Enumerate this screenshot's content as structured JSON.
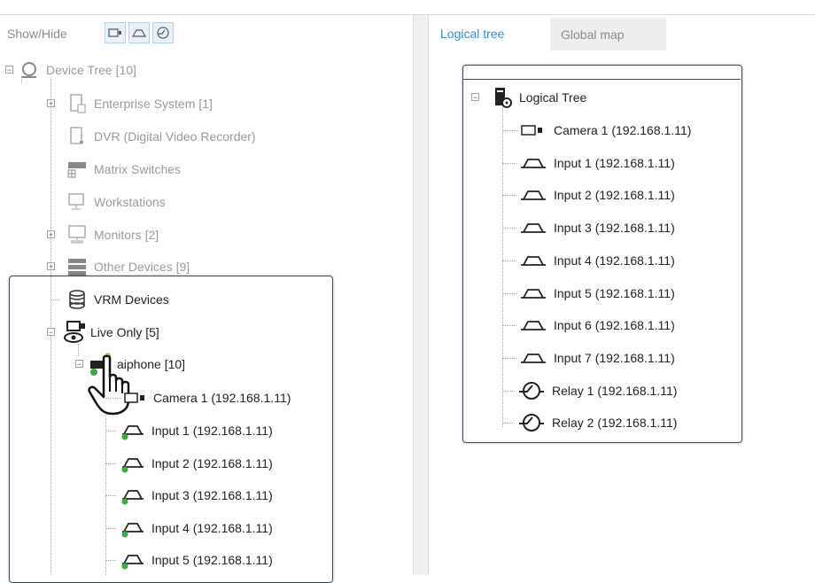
{
  "toolbar": {
    "show_hide_label": "Show/Hide"
  },
  "device_tree": {
    "root": "Device Tree [10]",
    "items": [
      {
        "label": "Enterprise System [1]",
        "icon": "enterprise-system-icon"
      },
      {
        "label": "DVR (Digital Video Recorder)",
        "icon": "dvr-icon"
      },
      {
        "label": "Matrix Switches",
        "icon": "matrix-switch-icon"
      },
      {
        "label": "Workstations",
        "icon": "workstation-icon"
      },
      {
        "label": "Monitors [2]",
        "icon": "monitor-icon"
      },
      {
        "label": "Other Devices [9]",
        "icon": "other-devices-icon"
      }
    ],
    "vrm": "VRM Devices",
    "live_only": "Live Only [5]",
    "aiphone": "aiphone [10]",
    "children": [
      "Camera 1 (192.168.1.11)",
      "Input 1 (192.168.1.11)",
      "Input 2 (192.168.1.11)",
      "Input 3 (192.168.1.11)",
      "Input 4 (192.168.1.11)",
      "Input 5 (192.168.1.11)"
    ]
  },
  "tabs": [
    {
      "label": "Logical tree",
      "active": true
    },
    {
      "label": "Global map",
      "active": false
    }
  ],
  "logical_tree": {
    "root": "Logical Tree",
    "items": [
      {
        "label": "Camera 1 (192.168.1.11)",
        "icon": "camera-icon"
      },
      {
        "label": "Input 1 (192.168.1.11)",
        "icon": "input-icon"
      },
      {
        "label": "Input 2 (192.168.1.11)",
        "icon": "input-icon"
      },
      {
        "label": "Input 3 (192.168.1.11)",
        "icon": "input-icon"
      },
      {
        "label": "Input 4 (192.168.1.11)",
        "icon": "input-icon"
      },
      {
        "label": "Input 5 (192.168.1.11)",
        "icon": "input-icon"
      },
      {
        "label": "Input 6 (192.168.1.11)",
        "icon": "input-icon"
      },
      {
        "label": "Input 7 (192.168.1.11)",
        "icon": "input-icon"
      },
      {
        "label": "Relay 1 (192.168.1.11)",
        "icon": "relay-icon"
      },
      {
        "label": "Relay 2 (192.168.1.11)",
        "icon": "relay-icon"
      }
    ]
  },
  "colors": {
    "accent": "#3b8bd6",
    "panel_border": "#3a4a5e",
    "dim_text": "#9a9a9a",
    "check": "#3aa845"
  }
}
